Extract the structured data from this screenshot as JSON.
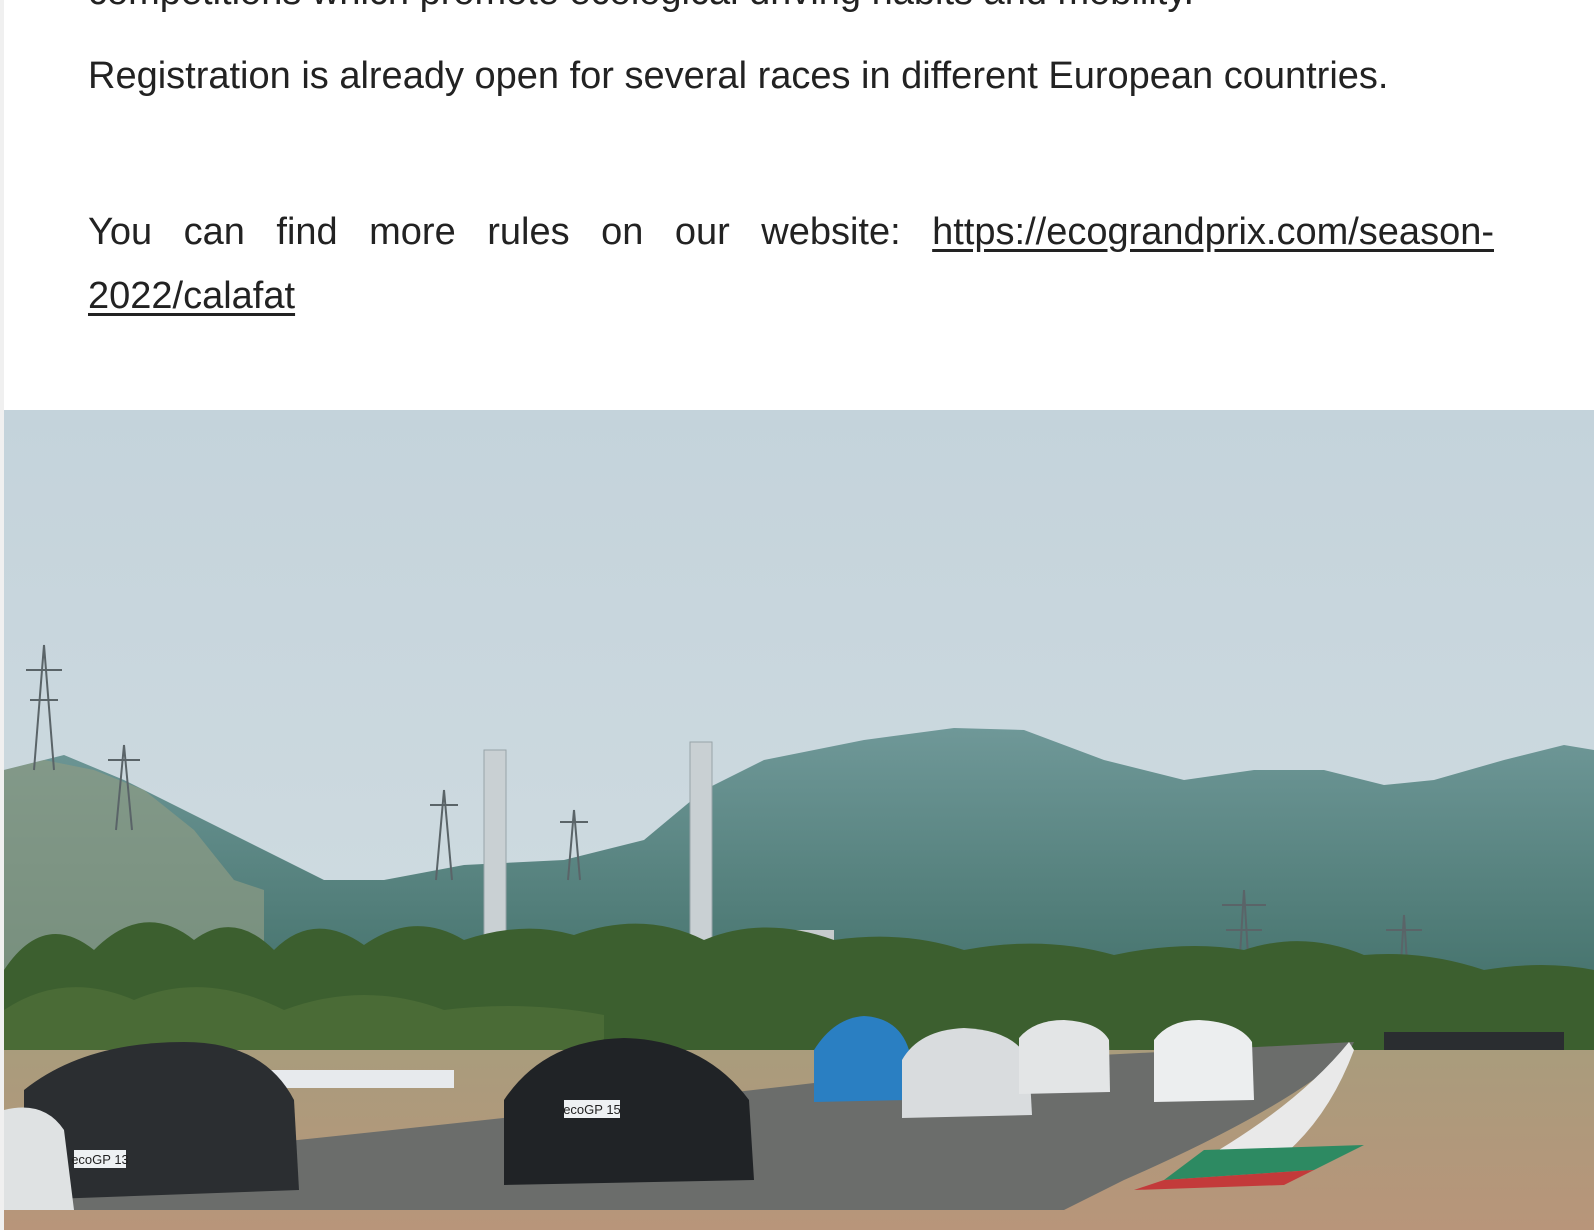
{
  "article": {
    "cut_off_line": "competitions which promote ecological driving habits and mobility.",
    "paragraph_1": "Registration is already open for several races in different European countries.",
    "paragraph_2_prefix": "You can find more rules on our website: ",
    "paragraph_2_link": "https://ecograndprix.com/season-2022/calafat "
  },
  "photo": {
    "subject": "electric cars racing on Calafat circuit track with hills and power towers in background",
    "plates": [
      "ecoGP 15",
      "ecoGP 13"
    ],
    "colors": {
      "sky": "#c6d5dc",
      "hills": "#5c8b8e",
      "trees": "#3b5d2e",
      "track": "#6a6c6a",
      "ground": "#b39878"
    }
  }
}
